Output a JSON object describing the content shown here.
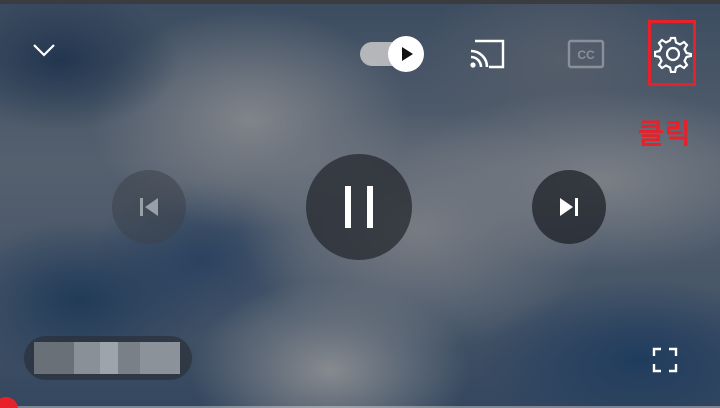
{
  "player": {
    "annotation_text": "클릭",
    "controls": {
      "minimize": "chevron-down-icon",
      "autoplay": "autoplay-toggle-icon",
      "cast": "cast-icon",
      "captions": "CC",
      "settings": "gear-icon",
      "previous": "previous-track-icon",
      "pause": "pause-icon",
      "next": "next-track-icon",
      "fullscreen": "fullscreen-icon"
    },
    "autoplay_on": true,
    "progress": 0
  },
  "colors": {
    "highlight": "#e8202a",
    "icon": "#ffffff"
  }
}
